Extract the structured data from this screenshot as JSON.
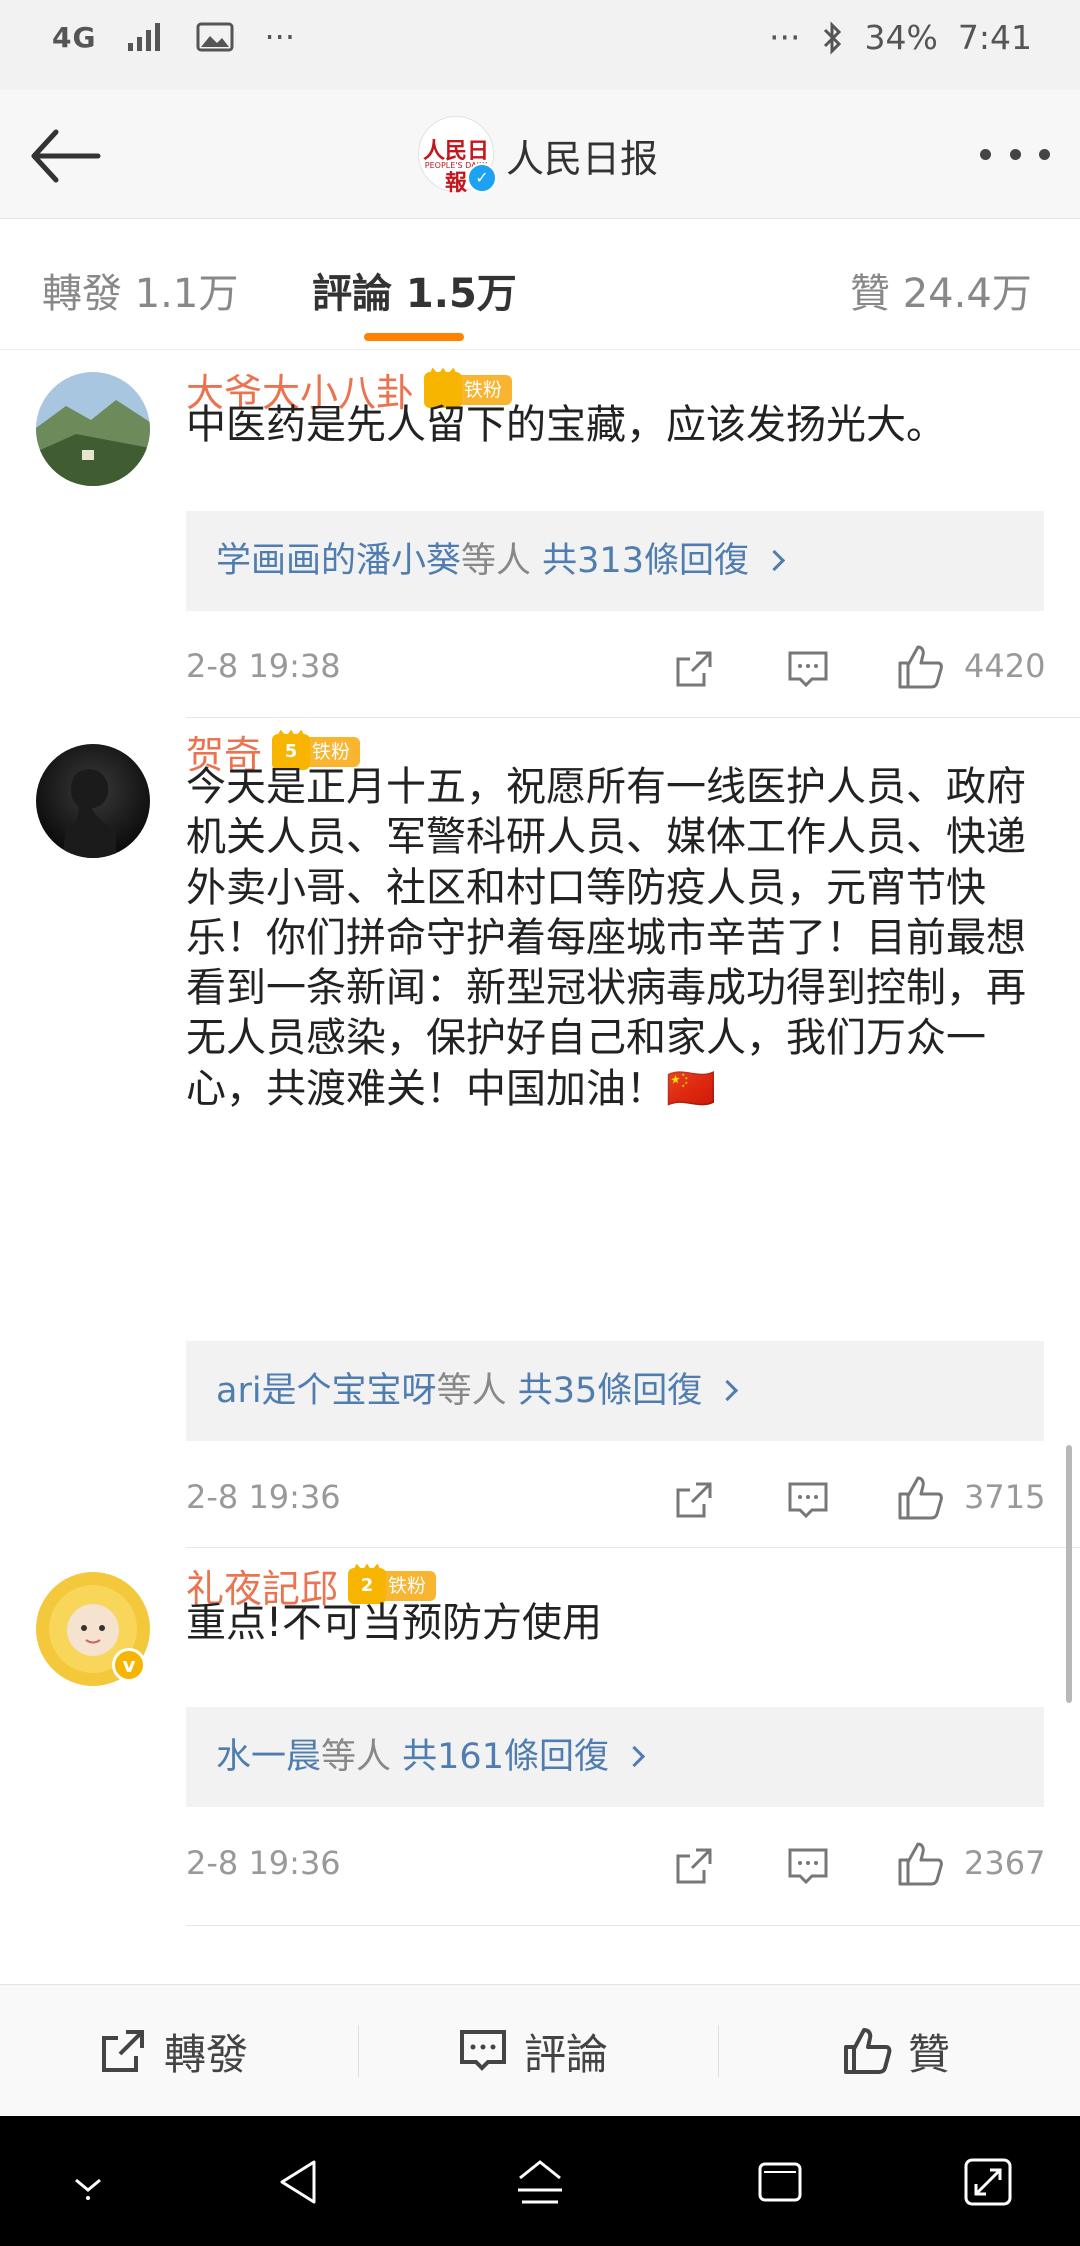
{
  "status_bar": {
    "network": "4G",
    "left_more": "···",
    "right_more": "···",
    "battery": "34%",
    "time": "7:41"
  },
  "header": {
    "logo_text": "人民日報",
    "logo_sub": "PEOPLE'S DAILY",
    "verified_mark": "✓",
    "title": "人民日报"
  },
  "tabs": {
    "repost": "轉發 1.1万",
    "comments": "評論 1.5万",
    "likes": "贊 24.4万"
  },
  "comments": [
    {
      "author": "大爷大小八卦",
      "fan_level": "",
      "fan_label": "铁粉",
      "text": "中医药是先人留下的宝藏，应该发扬光大。",
      "reply_users": "学画画的潘小葵",
      "reply_mid": "等人 ",
      "reply_count": "共313條回復",
      "time": "2-8 19:38",
      "likes": "4420"
    },
    {
      "author": "贺奇",
      "fan_level": "5",
      "fan_label": "铁粉",
      "text": "今天是正月十五，祝愿所有一线医护人员、政府机关人员、军警科研人员、媒体工作人员、快递外卖小哥、社区和村口等防疫人员，元宵节快乐！你们拼命守护着每座城市辛苦了！目前最想看到一条新闻：新型冠状病毒成功得到控制，再无人员感染，保护好自己和家人，我们万众一心，共渡难关！中国加油！🇨🇳",
      "reply_users": "ari是个宝宝呀",
      "reply_mid": "等人 ",
      "reply_count": "共35條回復",
      "time": "2-8 19:36",
      "likes": "3715"
    },
    {
      "author": "礼夜記邱",
      "fan_level": "2",
      "fan_label": "铁粉",
      "text": "重点!不可当预防方使用",
      "reply_users": "水一晨",
      "reply_mid": "等人 ",
      "reply_count": "共161條回復",
      "time": "2-8 19:36",
      "likes": "2367"
    }
  ],
  "action_bar": {
    "repost": "轉發",
    "comment": "評論",
    "like": "贊"
  },
  "colors": {
    "accent": "#ff8200",
    "author": "#eb7350",
    "link": "#507daf",
    "fan_badge": "#f9b430"
  }
}
